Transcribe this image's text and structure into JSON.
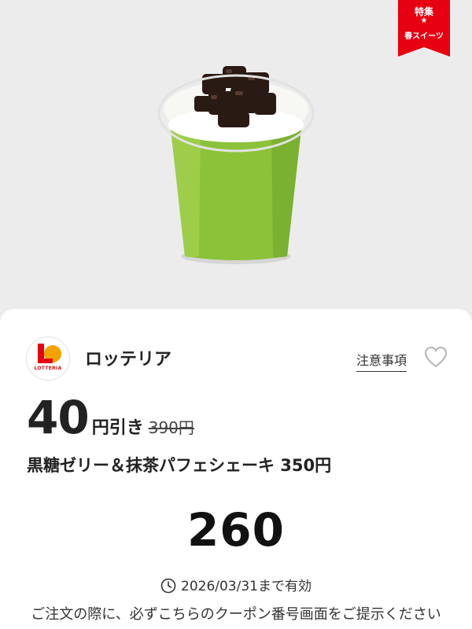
{
  "ribbon": {
    "line1": "特集",
    "star": "★",
    "line2": "春スイーツ"
  },
  "store": {
    "logo_text": "LOTTERIA",
    "name": "ロッテリア"
  },
  "notes_link": "注意事項",
  "coupon": {
    "discount_value": "40",
    "discount_unit": "円引き",
    "original_price": "390円",
    "product_name": "黒糖ゼリー＆抹茶パフェシェーキ 350円",
    "code": "260",
    "expiry": "2026/03/31まで有効",
    "notice": "ご注文の際に、必ずこちらのクーポン番号画面をご提示ください"
  },
  "colors": {
    "brand_red": "#e60012",
    "brand_orange": "#f5a200",
    "matcha": "#8cc13a"
  },
  "icons": {
    "favorite": "heart-outline-icon",
    "expiry": "clock-icon"
  }
}
